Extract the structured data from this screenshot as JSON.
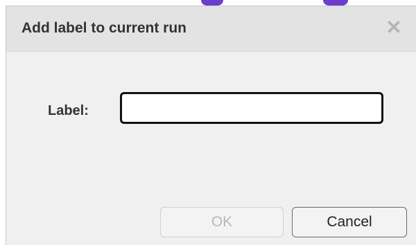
{
  "dialog": {
    "title": "Add label to current run",
    "close_glyph": "✕",
    "close_icon": "close-icon",
    "field_label": "Label:",
    "input_value": "",
    "input_placeholder": "",
    "ok_label": "OK",
    "ok_enabled": false,
    "cancel_label": "Cancel"
  },
  "colors": {
    "accent_background_marks": "#6a3fc9"
  }
}
